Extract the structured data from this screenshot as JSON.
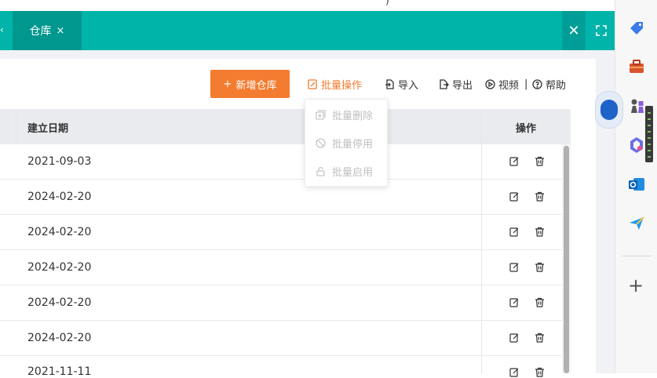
{
  "tabs": {
    "active_label": "仓库",
    "close_glyph": "×"
  },
  "toolbar": {
    "add_label": "新增仓库",
    "batch_label": "批量操作",
    "import_label": "导入",
    "export_label": "导出",
    "video_label": "视频",
    "separator": "|",
    "help_label": "帮助"
  },
  "dropdown": {
    "items": [
      {
        "label": "批量删除",
        "icon": "batch-delete-icon"
      },
      {
        "label": "批量停用",
        "icon": "disable-icon"
      },
      {
        "label": "批量启用",
        "icon": "lock-icon"
      }
    ]
  },
  "table": {
    "columns": [
      "建立日期",
      "操作"
    ],
    "rows": [
      {
        "date": "2021-09-03"
      },
      {
        "date": "2024-02-20"
      },
      {
        "date": "2024-02-20"
      },
      {
        "date": "2024-02-20"
      },
      {
        "date": "2024-02-20"
      },
      {
        "date": "2024-02-20"
      },
      {
        "date": "2021-11-11"
      }
    ]
  },
  "colors": {
    "teal": "#00b4aa",
    "teal_dark": "#00978f",
    "orange": "#f47c30"
  }
}
